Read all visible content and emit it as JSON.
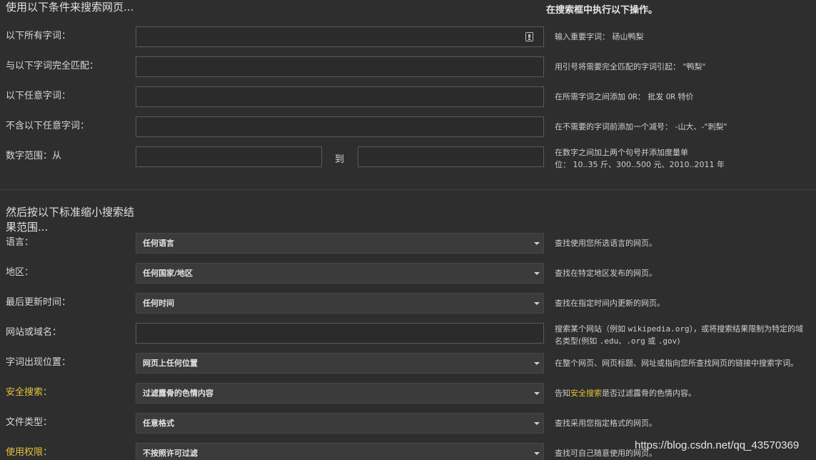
{
  "section1": {
    "title": "使用以下条件来搜索网页...",
    "hint": "在搜索框中执行以下操作。"
  },
  "section2": {
    "title": "然后按以下标准缩小搜索结果范围..."
  },
  "rows": {
    "all_words": {
      "label": "以下所有字词：",
      "help": "输入重要字词： 砀山鸭梨"
    },
    "exact": {
      "label": "与以下字词完全匹配：",
      "help": "用引号将需要完全匹配的字词引起： \"鸭梨\""
    },
    "any_words": {
      "label": "以下任意字词：",
      "help_pre": "在所需字词之间添加 ",
      "help_or": "OR",
      "help_mid": "： 批发 ",
      "help_or2": "OR",
      "help_post": " 特价"
    },
    "none_words": {
      "label": "不含以下任意字词：",
      "help": "在不需要的字词前添加一个减号： -山大、-\"刺梨\""
    },
    "range": {
      "label": "数字范围：从",
      "to": "到",
      "help1": "在数字之间加上两个句号并添加度量单",
      "help2": "位： 10..35 斤、300..500 元、2010..2011 年"
    },
    "language": {
      "label": "语言：",
      "value": "任何语言",
      "help": "查找使用您所选语言的网页。"
    },
    "region": {
      "label": "地区：",
      "value": "任何国家/地区",
      "help": "查找在特定地区发布的网页。"
    },
    "last_update": {
      "label": "最后更新时间：",
      "value": "任何时间",
      "help": "查找在指定时间内更新的网页。"
    },
    "site": {
      "label": "网站或域名：",
      "help_pre": "搜索某个网站（例如 ",
      "help_code": "wikipedia.org",
      "help_mid": "），或将搜索结果限制为特定的域",
      "help2_pre": "名类型(例如 ",
      "help2_code1": ".edu",
      "help2_sep1": "、",
      "help2_code2": ".org",
      "help2_sep2": " 或 ",
      "help2_code3": ".gov",
      "help2_post": ")"
    },
    "position": {
      "label": "字词出现位置：",
      "value": "网页上任何位置",
      "help": "在整个网页、网页标题、网址或指向您所查找网页的链接中搜索字词。"
    },
    "safesearch": {
      "label": "安全搜索：",
      "value": "过滤露骨的色情内容",
      "help_pre": "告知",
      "help_link": "安全搜索",
      "help_post": "是否过滤露骨的色情内容。"
    },
    "filetype": {
      "label": "文件类型：",
      "value": "任意格式",
      "help": "查找采用您指定格式的网页。"
    },
    "rights": {
      "label": "使用权限：",
      "value": "不按照许可过滤",
      "help": "查找可自己随意使用的网页。"
    }
  },
  "watermark": "https://blog.csdn.net/qq_43570369",
  "colors": {
    "background": "#2e2e2e",
    "highlight": "#e2c23c",
    "select_bg": "#3b3b3b"
  },
  "icons": {
    "keyboard": "keyboard-icon",
    "dropdown": "chevron-down-icon"
  }
}
